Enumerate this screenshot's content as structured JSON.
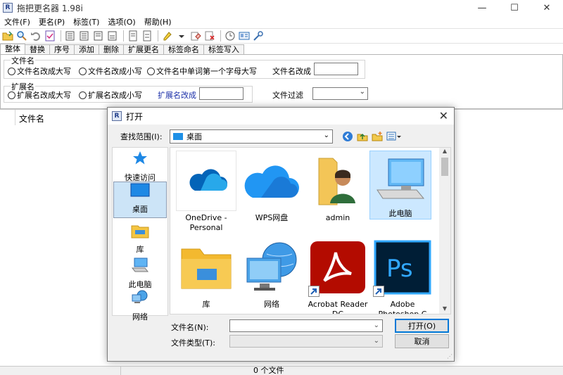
{
  "app": {
    "title": "拖把更名器 1.98i",
    "icon_letter": "R"
  },
  "window_controls": {
    "minimize": "—",
    "maximize": "☐",
    "close": "✕"
  },
  "menu": [
    "文件(F)",
    "更名(P)",
    "标签(T)",
    "选项(O)",
    "帮助(H)"
  ],
  "tabs": [
    {
      "label": "整体",
      "active": true
    },
    {
      "label": "替换"
    },
    {
      "label": "序号"
    },
    {
      "label": "添加"
    },
    {
      "label": "删除"
    },
    {
      "label": "扩展更名"
    },
    {
      "label": "标签命名"
    },
    {
      "label": "标签写入"
    }
  ],
  "filename_group": {
    "title": "文件名",
    "options": [
      "文件名改成大写",
      "文件名改成小写",
      "文件名中单词第一个字母大写"
    ],
    "rename_label": "文件名改成",
    "rename_value": ""
  },
  "ext_group": {
    "title": "扩展名",
    "options": [
      "扩展名改成大写",
      "扩展名改成小写"
    ],
    "rename_label": "扩展名改成",
    "rename_value": ""
  },
  "filter": {
    "label": "文件过滤",
    "value": ""
  },
  "file_list": {
    "column_name": "文件名"
  },
  "status": {
    "file_count": "0 个文件"
  },
  "dialog": {
    "title": "打开",
    "icon_letter": "R",
    "close": "✕",
    "look_in_label": "查找范围(I):",
    "look_in_value": "桌面",
    "places": [
      {
        "label": "快速访问",
        "icon": "star-icon"
      },
      {
        "label": "桌面",
        "icon": "desktop-icon",
        "selected": true
      },
      {
        "label": "库",
        "icon": "library-icon"
      },
      {
        "label": "此电脑",
        "icon": "computer-icon"
      },
      {
        "label": "网络",
        "icon": "network-icon"
      }
    ],
    "files": [
      {
        "name": "OneDrive - Personal",
        "icon": "onedrive-icon"
      },
      {
        "name": "WPS网盘",
        "icon": "wps-cloud-icon"
      },
      {
        "name": "admin",
        "icon": "user-folder-icon"
      },
      {
        "name": "此电脑",
        "icon": "computer-icon",
        "selected": true
      },
      {
        "name": "库",
        "icon": "library-folder-icon"
      },
      {
        "name": "网络",
        "icon": "network-icon"
      },
      {
        "name": "Acrobat Reader DC",
        "icon": "acrobat-icon",
        "shortcut": true
      },
      {
        "name": "Adobe Photoshop C",
        "icon": "photoshop-icon",
        "shortcut": true
      }
    ],
    "filename_label": "文件名(N):",
    "filename_value": "",
    "filetype_label": "文件类型(T):",
    "filetype_value": "",
    "open_button": "打开(O)",
    "cancel_button": "取消"
  },
  "colors": {
    "accent_blue": "#0078d7",
    "selection_bg": "#cce8ff",
    "acrobat_red": "#b30b00",
    "photoshop_blue": "#001e36",
    "photoshop_text": "#31a8ff"
  }
}
